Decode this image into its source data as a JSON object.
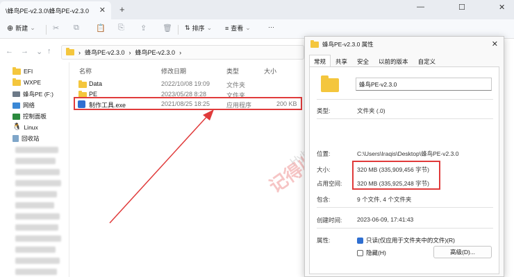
{
  "tab": {
    "title": "\\蜂鸟PE-v2.3.0\\蜂鸟PE-v2.3.0",
    "close": "✕",
    "new": "+"
  },
  "window": {
    "minimize": "—",
    "maximize": "☐",
    "close": "✕"
  },
  "toolbar": {
    "new_label": "新建",
    "sort_label": "排序",
    "view_label": "查看",
    "more": "···"
  },
  "address": {
    "back": "←",
    "forward": "→",
    "dropdown": "⌄",
    "up": "↑",
    "crumbs": [
      "蜂鸟PE-v2.3.0",
      "蜂鸟PE-v2.3.0"
    ],
    "separator": "›"
  },
  "sidebar": {
    "items": [
      {
        "label": "EFI"
      },
      {
        "label": "WXPE"
      },
      {
        "label": "蜂鸟PE (F:)"
      },
      {
        "label": "网络"
      },
      {
        "label": "控制面板"
      },
      {
        "label": "Linux"
      },
      {
        "label": "回收站"
      }
    ]
  },
  "filelist": {
    "headers": {
      "name": "名称",
      "date": "修改日期",
      "type": "类型",
      "size": "大小"
    },
    "rows": [
      {
        "name": "Data",
        "date": "2022/10/08 19:09",
        "type": "文件夹",
        "size": ""
      },
      {
        "name": "PE",
        "date": "2023/05/28 8:28",
        "type": "文件夹",
        "size": ""
      },
      {
        "name": "制作工具.exe",
        "date": "2021/08/25 18:25",
        "type": "应用程序",
        "size": "200 KB"
      }
    ]
  },
  "watermark": {
    "text": "记得收藏:黑域基地",
    "sub": "Hybase"
  },
  "dialog": {
    "title": "蜂鸟PE-v2.3.0 属性",
    "close": "✕",
    "tabs": [
      "常规",
      "共享",
      "安全",
      "以前的版本",
      "自定义"
    ],
    "name": "蜂鸟PE-v2.3.0",
    "props": {
      "type_label": "类型:",
      "type_value": "文件夹 (.0)",
      "location_label": "位置:",
      "location_value": "C:\\Users\\Iraqis\\Desktop\\蜂鸟PE-v2.3.0",
      "size_label": "大小:",
      "size_value": "320 MB (335,909,456 字节)",
      "disk_label": "占用空间:",
      "disk_value": "320 MB (335,925,248 字节)",
      "contains_label": "包含:",
      "contains_value": "9 个文件, 4 个文件夹",
      "created_label": "创建时间:",
      "created_value": "2023-06-09, 17:41:43",
      "attr_label": "属性:",
      "readonly_label": "只读(仅应用于文件夹中的文件)(R)",
      "hidden_label": "隐藏(H)",
      "advanced_label": "高级(D)..."
    }
  },
  "colors": {
    "accent": "#2f6fd1",
    "highlight": "#e03a3a",
    "folder": "#f4c63d"
  }
}
